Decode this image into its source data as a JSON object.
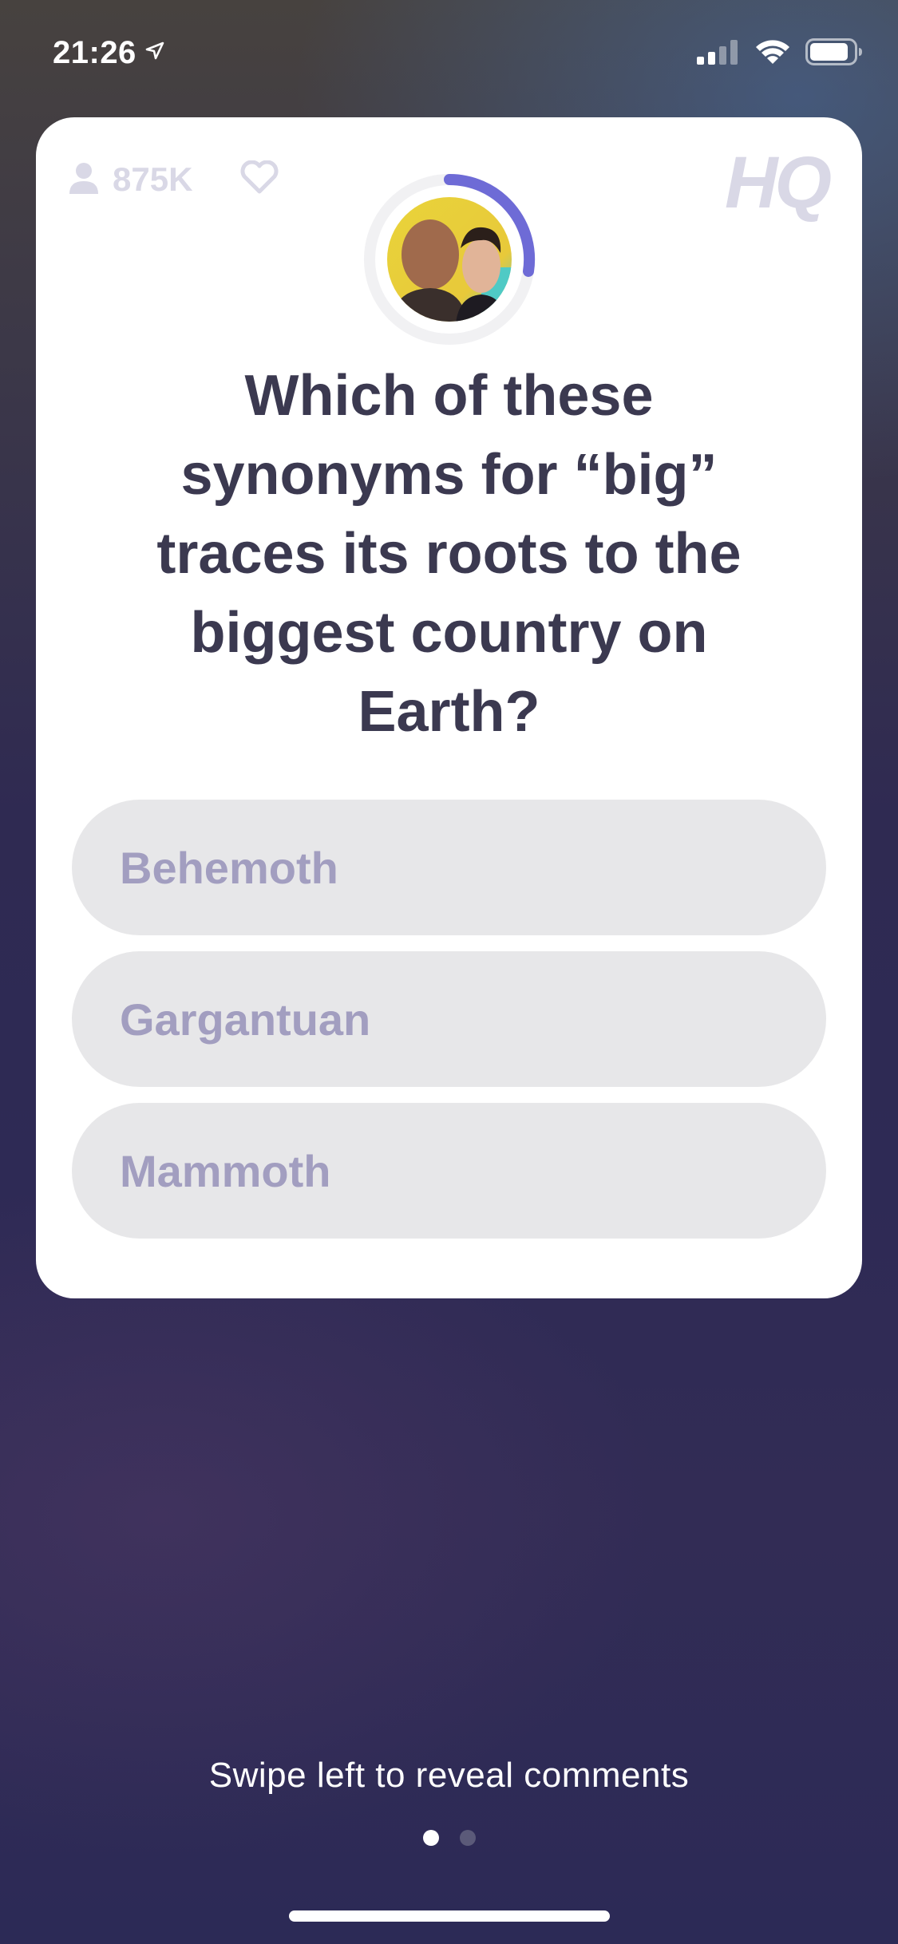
{
  "status_bar": {
    "time": "21:26",
    "location_icon": "location-arrow-icon",
    "signal_icon": "cellular-signal-icon",
    "wifi_icon": "wifi-icon",
    "battery_icon": "battery-icon"
  },
  "card": {
    "viewers": "875K",
    "viewer_icon": "person-icon",
    "heart_icon": "heart-icon",
    "logo": "HQ",
    "timer_color": "#6e6bd6",
    "question": "Which of these synonyms for “big” traces its roots to the biggest country on Earth?",
    "answers": [
      {
        "label": "Behemoth"
      },
      {
        "label": "Gargantuan"
      },
      {
        "label": "Mammoth"
      }
    ]
  },
  "footer": {
    "swipe_hint": "Swipe left to reveal comments",
    "page_count": 2,
    "active_page": 1
  },
  "colors": {
    "card_background": "#ffffff",
    "question_text": "#3b3950",
    "answer_background": "#e7e7e9",
    "answer_text": "#a29ec0",
    "muted": "#d9d8e6"
  }
}
